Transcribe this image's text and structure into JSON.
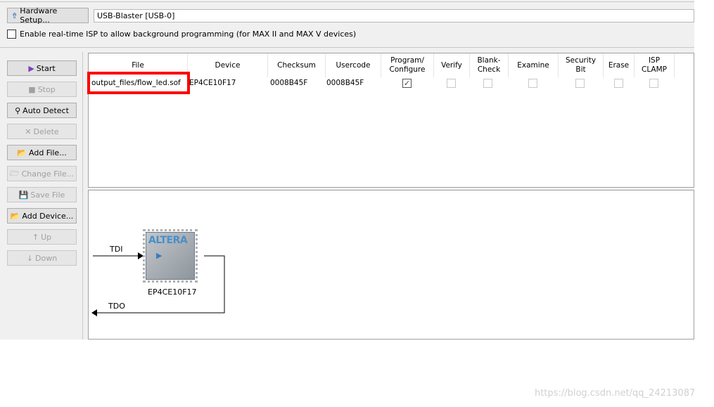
{
  "toolbar": {
    "hardware_setup": "Hardware Setup...",
    "hardware_value": "USB-Blaster [USB-0]",
    "isp_label": "Enable real-time ISP to allow background programming (for MAX II and MAX V devices)",
    "isp_checked": false
  },
  "buttons": [
    {
      "label": "Start",
      "icon": "start-icon",
      "enabled": true
    },
    {
      "label": "Stop",
      "icon": "stop-icon",
      "enabled": false
    },
    {
      "label": "Auto Detect",
      "icon": "auto-detect-icon",
      "enabled": true
    },
    {
      "label": "Delete",
      "icon": "delete-icon",
      "enabled": false
    },
    {
      "label": "Add File...",
      "icon": "add-file-icon",
      "enabled": true
    },
    {
      "label": "Change File...",
      "icon": "change-file-icon",
      "enabled": false
    },
    {
      "label": "Save File",
      "icon": "save-file-icon",
      "enabled": false
    },
    {
      "label": "Add Device...",
      "icon": "add-device-icon",
      "enabled": true
    },
    {
      "label": "Up",
      "icon": "up-icon",
      "enabled": false
    },
    {
      "label": "Down",
      "icon": "down-icon",
      "enabled": false
    }
  ],
  "table": {
    "columns": [
      "File",
      "Device",
      "Checksum",
      "Usercode",
      "Program/\nConfigure",
      "Verify",
      "Blank-\nCheck",
      "Examine",
      "Security\nBit",
      "Erase",
      "ISP\nCLAMP"
    ],
    "row": {
      "file": "output_files/flow_led.sof",
      "device": "EP4CE10F17",
      "checksum": "0008B45F",
      "usercode": "0008B45F",
      "program": true,
      "verify": false,
      "blank_check": false,
      "examine": false,
      "security_bit": false,
      "erase": false,
      "isp_clamp": false
    }
  },
  "diagram": {
    "tdi": "TDI",
    "tdo": "TDO",
    "chip_label": "EP4CE10F17",
    "logo": "ALTERA"
  },
  "highlight_color": "#ff0000",
  "watermark": "https://blog.csdn.net/qq_24213087"
}
